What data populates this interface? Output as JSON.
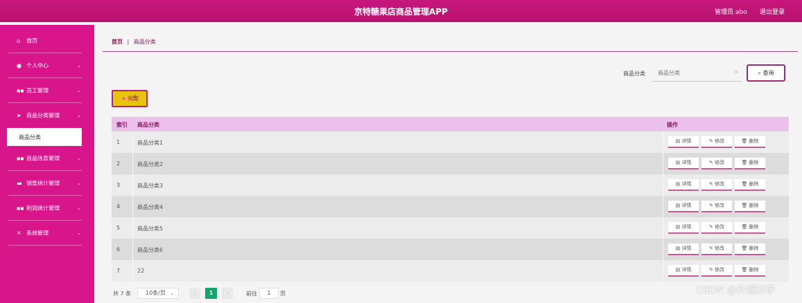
{
  "header": {
    "title": "京特糖果店商品管理APP",
    "admin": "管理员 abo",
    "logout": "退出登录"
  },
  "sidebar": {
    "items": [
      {
        "icon": "home-icon",
        "glyph": "⌂",
        "label": "首页",
        "chevron": false
      },
      {
        "icon": "user-icon",
        "glyph": "●",
        "label": "个人中心",
        "chevron": true
      },
      {
        "icon": "grid-icon",
        "glyph": "▪▪",
        "label": "员工管理",
        "chevron": true
      },
      {
        "icon": "send-icon",
        "glyph": "➤",
        "label": "商品分类管理",
        "chevron": true,
        "open": true
      },
      {
        "icon": "grid-icon",
        "glyph": "▪▪",
        "label": "商品信息管理",
        "chevron": true
      },
      {
        "icon": "chart-icon",
        "glyph": "▬",
        "label": "销售统计管理",
        "chevron": true
      },
      {
        "icon": "grid-icon",
        "glyph": "▪▪",
        "label": "利润统计管理",
        "chevron": true
      },
      {
        "icon": "settings-icon",
        "glyph": "✕",
        "label": "系统管理",
        "chevron": true
      }
    ],
    "submenu_label": "商品分类"
  },
  "breadcrumb": {
    "home": "首页",
    "sep": "|",
    "current": "商品分类"
  },
  "search": {
    "label": "商品分类",
    "placeholder": "商品分类",
    "button": "查询"
  },
  "add_button": "新增",
  "table": {
    "headers": {
      "index": "索引",
      "name": "商品分类",
      "ops": "操作"
    },
    "rows": [
      {
        "index": "1",
        "name": "商品分类1"
      },
      {
        "index": "2",
        "name": "商品分类2"
      },
      {
        "index": "3",
        "name": "商品分类3"
      },
      {
        "index": "4",
        "name": "商品分类4"
      },
      {
        "index": "5",
        "name": "商品分类5"
      },
      {
        "index": "6",
        "name": "商品分类6"
      },
      {
        "index": "7",
        "name": "22"
      }
    ],
    "ops": {
      "detail": "详情",
      "edit": "修改",
      "delete": "删除"
    }
  },
  "pagination": {
    "total": "共 7 条",
    "page_size": "10条/页",
    "current": "1",
    "goto_label": "前往",
    "goto_value": "1",
    "page_suffix": "页"
  },
  "watermark": "CSDN @升幅科学",
  "colors": {
    "topbar": "#c0157a",
    "sidebar": "#d8158b",
    "table_header": "#ecc0ec",
    "add_button": "#e8c40c",
    "current_page": "#18a36b"
  }
}
